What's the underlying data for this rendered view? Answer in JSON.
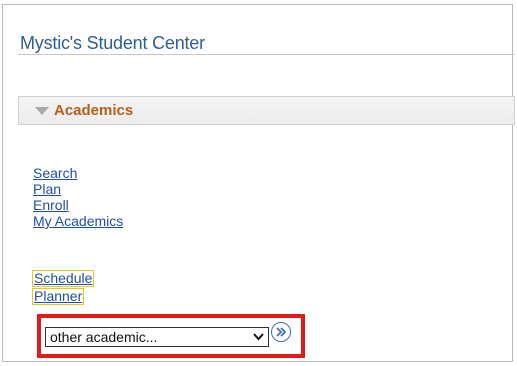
{
  "header": {
    "title": "Mystic's Student Center"
  },
  "academics": {
    "section_title": "Academics",
    "links": [
      "Search",
      "Plan",
      "Enroll",
      "My Academics"
    ],
    "schedule_planner": {
      "line1": "Schedule",
      "line2": "Planner"
    },
    "select": {
      "value": "other academic..."
    },
    "go_icon": "double-chevron-right-icon"
  },
  "colors": {
    "title": "#2e5f8f",
    "section_title": "#b45f1c",
    "link": "#1f4fa3",
    "highlight": "#e11a1a",
    "outline": "#f0c419"
  }
}
